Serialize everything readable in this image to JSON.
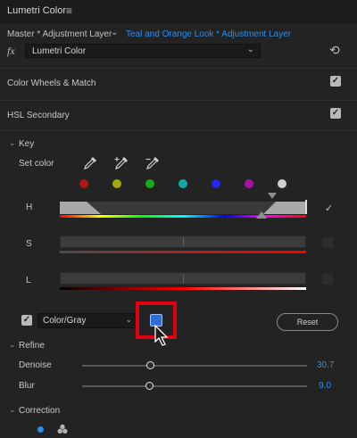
{
  "panel": {
    "title": "Lumetri Color",
    "menu_icon": "hamburger-menu-icon"
  },
  "source": {
    "master_label": "Master * Adjustment Layer",
    "clip_label": "Teal and Orange Look * Adjustment Layer"
  },
  "effect": {
    "fx_label": "fx",
    "selected": "Lumetri Color"
  },
  "sections": {
    "color_wheels": {
      "label": "Color Wheels & Match",
      "checked": true
    },
    "hsl": {
      "label": "HSL Secondary",
      "checked": true
    }
  },
  "key": {
    "label": "Key",
    "set_color_label": "Set color",
    "swatch_colors": [
      "#b01616",
      "#a7a70f",
      "#19a619",
      "#14a6a6",
      "#2626f2",
      "#a614a6",
      "#cfcfcf"
    ],
    "h_label": "H",
    "s_label": "S",
    "l_label": "L"
  },
  "mask": {
    "mode": "Color/Gray",
    "reset_label": "Reset"
  },
  "refine": {
    "label": "Refine",
    "denoise": {
      "label": "Denoise",
      "value": "30.7",
      "fraction": 0.307
    },
    "blur": {
      "label": "Blur",
      "value": "9.0",
      "fraction": 0.3
    }
  },
  "correction": {
    "label": "Correction"
  },
  "colors": {
    "accent": "#2d8ceb",
    "highlight": "#e0000f"
  }
}
